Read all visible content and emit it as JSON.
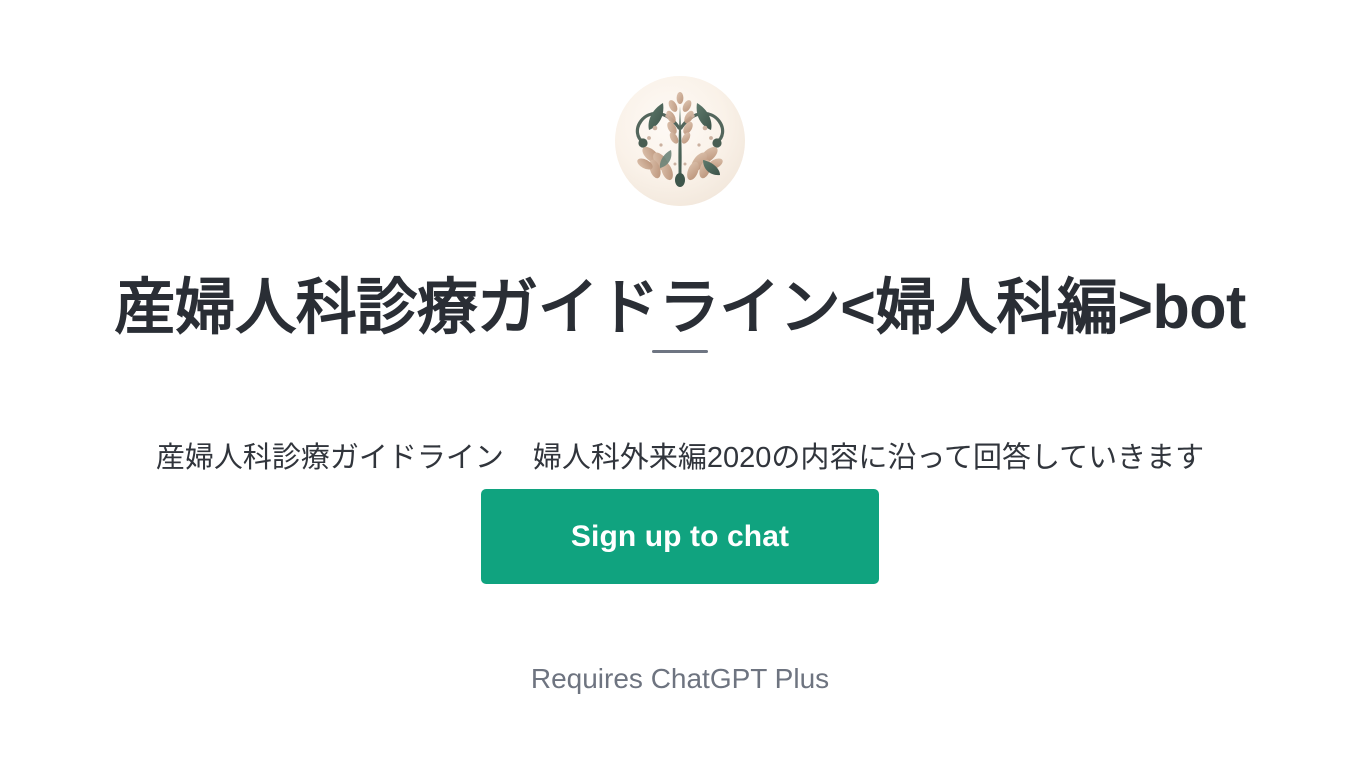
{
  "page": {
    "background_color": "#ffffff"
  },
  "avatar": {
    "icon_name": "botanical-flourish-avatar",
    "alt": "産婦人科診療ガイドライン<婦人科編>bot",
    "background_color": "#faf2e9",
    "leaf_green": "#4a6459",
    "leaf_tan": "#c9a88c",
    "stem_color": "#53665c"
  },
  "header": {
    "title": "産婦人科診療ガイドライン<婦人科編>bot",
    "title_color": "#2a2e35",
    "divider_color": "#6e7582"
  },
  "description": {
    "text": "産婦人科診療ガイドライン　婦人科外来編2020の内容に沿って回答していきます",
    "color": "#31353c"
  },
  "cta": {
    "label": "Sign up to chat",
    "background_color": "#10a37f",
    "text_color": "#ffffff"
  },
  "footer": {
    "requires_text": "Requires ChatGPT Plus",
    "color": "#6e7480"
  }
}
